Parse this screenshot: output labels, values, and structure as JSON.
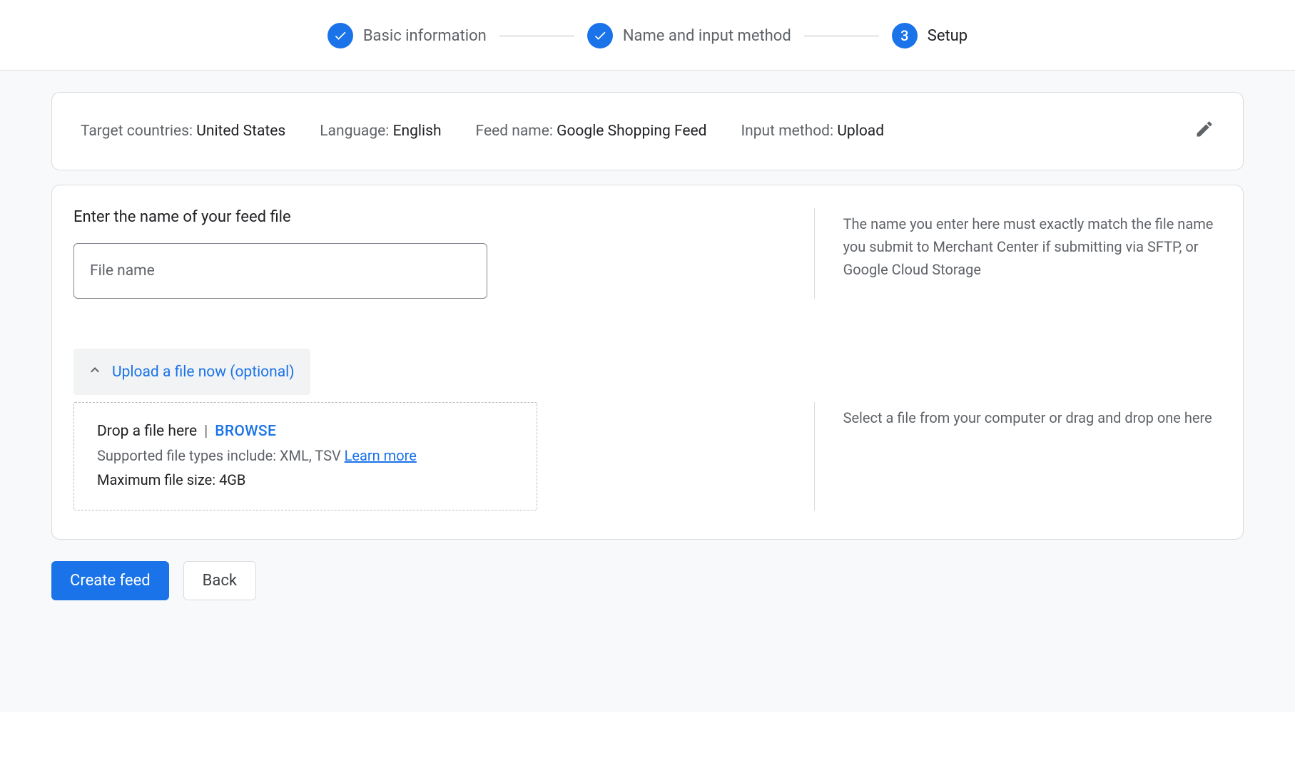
{
  "stepper": {
    "steps": [
      {
        "label": "Basic information",
        "done": true
      },
      {
        "label": "Name and input method",
        "done": true
      },
      {
        "label": "Setup",
        "number": "3",
        "done": false
      }
    ]
  },
  "summary": {
    "target_countries_label": "Target countries: ",
    "target_countries_value": "United States",
    "language_label": "Language: ",
    "language_value": "English",
    "feed_name_label": "Feed name: ",
    "feed_name_value": "Google Shopping Feed",
    "input_method_label": "Input method: ",
    "input_method_value": "Upload"
  },
  "form": {
    "section_title": "Enter the name of your feed file",
    "file_name_placeholder": "File name",
    "file_name_value": "",
    "help_text_1": "The name you enter here must exactly match the file name you submit to Merchant Center if submitting via SFTP, or Google Cloud Storage",
    "accordion_title": "Upload a file now (optional)",
    "dropzone": {
      "drop_text": "Drop a file here",
      "separator": "|",
      "browse_label": "BROWSE",
      "supported_text": "Supported file types include: XML, TSV ",
      "learn_more": "Learn more",
      "max_size": "Maximum file size: 4GB"
    },
    "help_text_2": "Select a file from your computer or drag and drop one here"
  },
  "actions": {
    "primary": "Create feed",
    "secondary": "Back"
  }
}
